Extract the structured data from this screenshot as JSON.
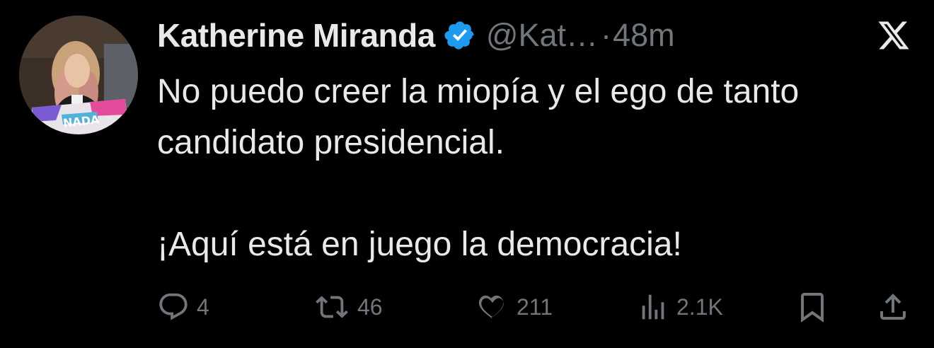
{
  "tweet": {
    "author_name": "Katherine Miranda",
    "handle": "@Kat…",
    "separator": "·",
    "time": "48m",
    "text": "No puedo creer la miopía y el ego de tanto\ncandidato presidencial.\n\n¡Aquí está en juego la democracia!",
    "verified": true,
    "avatar_banner_text": "NADA"
  },
  "actions": {
    "replies": "4",
    "reposts": "46",
    "likes": "211",
    "views": "2.1K"
  },
  "colors": {
    "background": "#000000",
    "text_primary": "#e7e9ea",
    "text_secondary": "#71767b",
    "verified_badge": "#1d9bf0"
  },
  "icons": {
    "platform": "x-logo-icon",
    "verified": "verified-badge-icon",
    "reply": "reply-icon",
    "repost": "repost-icon",
    "like": "heart-icon",
    "views": "views-icon",
    "bookmark": "bookmark-icon",
    "share": "share-icon"
  }
}
